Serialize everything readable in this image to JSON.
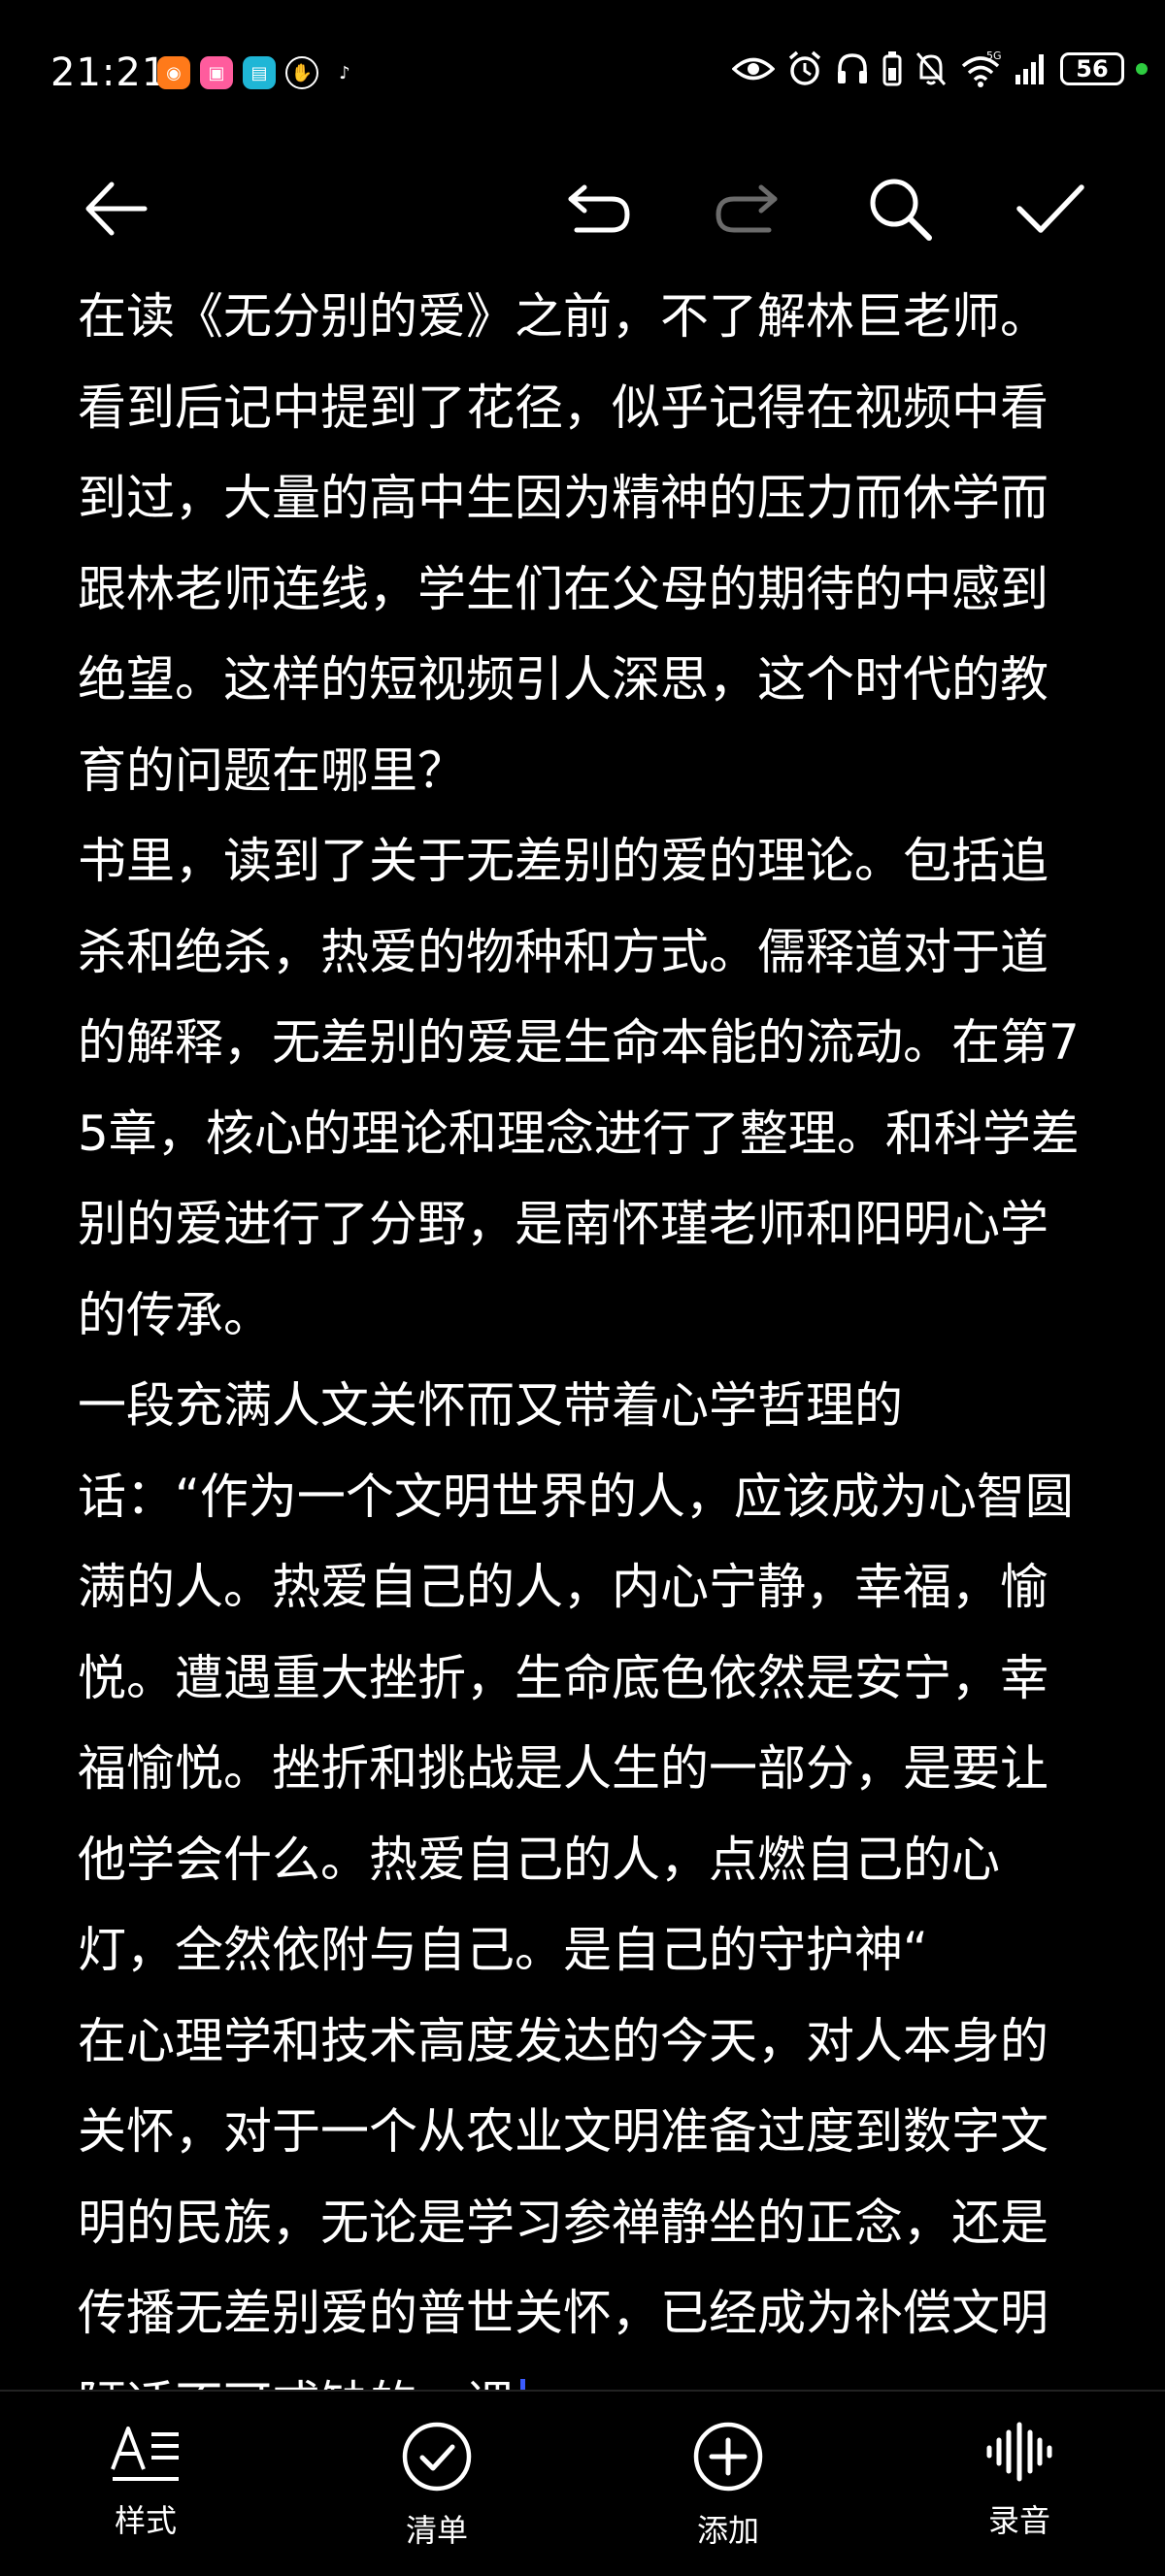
{
  "status_bar": {
    "time": "21:21",
    "network": "5G",
    "battery": "56",
    "app_icons": [
      "taobao-icon",
      "bilibili-icon",
      "reader-icon",
      "hand-icon",
      "tiktok-icon"
    ],
    "system_icons": [
      "eye-icon",
      "alarm-icon",
      "headphones-icon",
      "battery-saver-icon",
      "mute-icon",
      "wifi-icon",
      "signal-icon"
    ]
  },
  "toolbar": {
    "icons": [
      "back-arrow-icon",
      "undo-icon",
      "redo-icon",
      "search-icon",
      "check-icon"
    ],
    "redo_disabled": true
  },
  "editor": {
    "paragraphs": [
      "在读《无分别的爱》之前，不了解林巨老师。看到后记中提到了花径，似乎记得在视频中看到过，大量的高中生因为精神的压力而休学而跟林老师连线，学生们在父母的期待的中感到绝望。这样的短视频引人深思，这个时代的教育的问题在哪里？",
      "书里，读到了关于无差别的爱的理论。包括追杀和绝杀，热爱的物种和方式。儒释道对于道的解释，无差别的爱是生命本能的流动。在第75章，核心的理论和理念进行了整理。和科学差别的爱进行了分野，是南怀瑾老师和阳明心学的传承。",
      "一段充满人文关怀而又带着心学哲理的",
      "话：“作为一个文明世界的人，应该成为心智圆满的人。热爱自己的人，内心宁静，幸福，愉悦。遭遇重大挫折，生命底色依然是安宁，幸福愉悦。挫折和挑战是人生的一部分，是要让他学会什么。热爱自己的人，点燃自己的心灯，全然依附与自己。是自己的守护神“",
      "在心理学和技术高度发达的今天，对人本身的关怀，对于一个从农业文明准备过度到数字文明的民族，无论是学习参禅静坐的正念，还是传播无差别爱的普世关怀，已经成为补偿文明陋适不可或缺的一课"
    ]
  },
  "bottom_bar": {
    "items": [
      {
        "label": "样式",
        "icon": "text-style-icon"
      },
      {
        "label": "清单",
        "icon": "checklist-icon"
      },
      {
        "label": "添加",
        "icon": "add-circle-icon"
      },
      {
        "label": "录音",
        "icon": "voice-record-icon"
      }
    ]
  },
  "colors": {
    "background": "#000000",
    "text": "#ffffff",
    "cursor": "#3b5bff",
    "disabled_icon": "#6b6b6b",
    "charging": "#2ecc40"
  }
}
